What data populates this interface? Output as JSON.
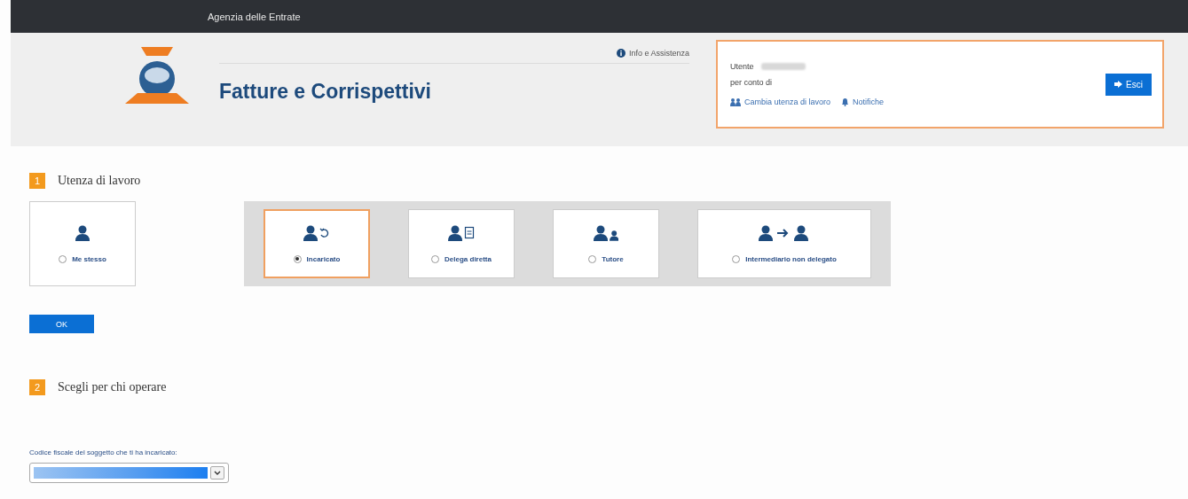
{
  "top_bar": {
    "title": "Agenzia delle Entrate"
  },
  "header": {
    "app_title": "Fatture e Corrispettivi",
    "help_link": "Info e Assistenza",
    "user_box": {
      "user_label": "Utente",
      "on_behalf_label": "per conto di",
      "links": [
        {
          "kind": "users",
          "label": "Cambia utenza di lavoro"
        },
        {
          "kind": "bell",
          "label": "Notifiche"
        }
      ],
      "exit_button": "Esci"
    }
  },
  "section_1": {
    "number": "1",
    "title": "Utenza di lavoro",
    "options": [
      {
        "kind": "self",
        "label": "Me stesso",
        "selected": false
      }
    ],
    "grouped_options": [
      {
        "kind": "appointed",
        "label": "Incaricato",
        "selected": true
      },
      {
        "kind": "document",
        "label": "Delega diretta",
        "selected": false
      },
      {
        "kind": "guardian",
        "label": "Tutore",
        "selected": false
      },
      {
        "kind": "intermediary",
        "label": "Intermediario non delegato",
        "selected": false
      }
    ],
    "ok_button": "OK"
  },
  "section_2": {
    "number": "2",
    "title": "Scegli per chi operare",
    "field_label": "Codice fiscale del soggetto che ti ha incaricato:"
  }
}
